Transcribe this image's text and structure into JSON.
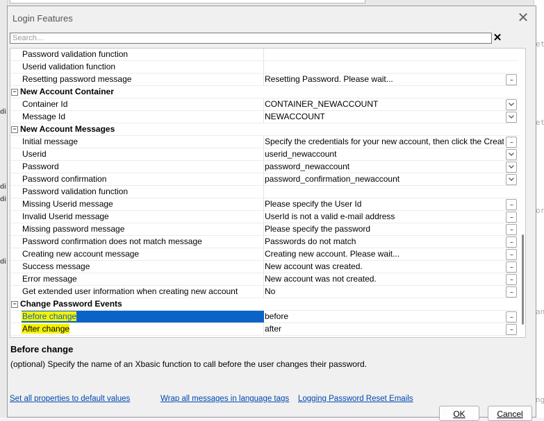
{
  "background": {
    "right_fragments": [
      "etl",
      "etl",
      "ord",
      "ang",
      "nge"
    ],
    "left_fragments": [
      "di",
      "di",
      "di",
      "di"
    ]
  },
  "dialog": {
    "title": "Login Features",
    "search": {
      "placeholder": "Search...",
      "value": ""
    },
    "clear_label": "✕"
  },
  "grid": {
    "rows": [
      {
        "type": "prop",
        "name": "Password validation function",
        "value": "",
        "control": "none"
      },
      {
        "type": "prop",
        "name": "Userid validation function",
        "value": "",
        "control": "none"
      },
      {
        "type": "prop",
        "name": "Resetting password message",
        "value": "Resetting Password. Please wait...",
        "control": "dots"
      },
      {
        "type": "cat",
        "name": "New Account Container"
      },
      {
        "type": "prop",
        "name": "Container Id",
        "value": "CONTAINER_NEWACCOUNT",
        "control": "chevron"
      },
      {
        "type": "prop",
        "name": "Message Id",
        "value": "NEWACCOUNT",
        "control": "chevron"
      },
      {
        "type": "cat",
        "name": "New Account Messages"
      },
      {
        "type": "prop",
        "name": "Initial message",
        "value": "Specify the credentials for your new account, then click the Create Account",
        "control": "dots"
      },
      {
        "type": "prop",
        "name": "Userid",
        "value": "userid_newaccount",
        "control": "chevron"
      },
      {
        "type": "prop",
        "name": "Password",
        "value": "password_newaccount",
        "control": "chevron"
      },
      {
        "type": "prop",
        "name": "Password confirmation",
        "value": "password_confirmation_newaccount",
        "control": "chevron"
      },
      {
        "type": "prop",
        "name": "Password validation function",
        "value": "",
        "control": "none"
      },
      {
        "type": "prop",
        "name": "Missing Userid message",
        "value": "Please specify the User Id",
        "control": "dots"
      },
      {
        "type": "prop",
        "name": "Invalid Userid message",
        "value": "UserId is not a valid e-mail address",
        "control": "dots"
      },
      {
        "type": "prop",
        "name": "Missing password message",
        "value": "Please specify the password",
        "control": "dots"
      },
      {
        "type": "prop",
        "name": "Password confirmation does not match message",
        "value": "Passwords do not match",
        "control": "dots"
      },
      {
        "type": "prop",
        "name": "Creating new account message",
        "value": "Creating new account. Please wait...",
        "control": "dots"
      },
      {
        "type": "prop",
        "name": "Success message",
        "value": "New account was created.",
        "control": "dots"
      },
      {
        "type": "prop",
        "name": "Error message",
        "value": "New account was not created.",
        "control": "dots"
      },
      {
        "type": "prop",
        "name": "Get extended user information when creating new account",
        "value": "No",
        "control": "dots"
      },
      {
        "type": "cat",
        "name": "Change Password Events"
      },
      {
        "type": "prop",
        "name": "Before change",
        "value": "before",
        "control": "dots",
        "selected": true,
        "highlight": true
      },
      {
        "type": "prop",
        "name": "After change",
        "value": "after",
        "control": "dots",
        "highlight": true
      }
    ]
  },
  "help": {
    "title": "Before change",
    "text": "(optional) Specify the name of an Xbasic function to call before the user changes their password."
  },
  "links": {
    "defaults": "Set all properties to default values",
    "wrap": "Wrap all messages in language tags",
    "logging": "Logging Password Reset Emails"
  },
  "buttons": {
    "ok": "OK",
    "cancel": "Cancel"
  },
  "colors": {
    "selection": "#0a64c8",
    "highlight": "#f5f200",
    "link": "#0047b3"
  }
}
